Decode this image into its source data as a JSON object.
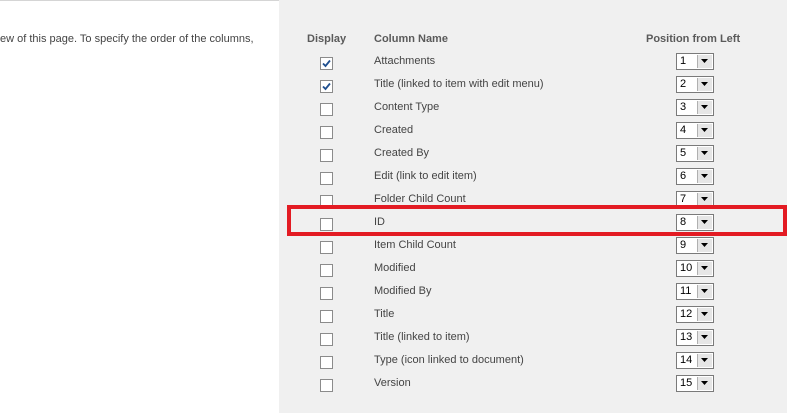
{
  "description": "ew of this page. To specify the order of the columns,",
  "table": {
    "headers": {
      "display": "Display",
      "column_name": "Column Name",
      "position": "Position from Left"
    },
    "rows": [
      {
        "name": "Attachments",
        "checked": true,
        "position": "1"
      },
      {
        "name": "Title (linked to item with edit menu)",
        "checked": true,
        "position": "2"
      },
      {
        "name": "Content Type",
        "checked": false,
        "position": "3"
      },
      {
        "name": "Created",
        "checked": false,
        "position": "4"
      },
      {
        "name": "Created By",
        "checked": false,
        "position": "5"
      },
      {
        "name": "Edit (link to edit item)",
        "checked": false,
        "position": "6"
      },
      {
        "name": "Folder Child Count",
        "checked": false,
        "position": "7"
      },
      {
        "name": "ID",
        "checked": false,
        "position": "8"
      },
      {
        "name": "Item Child Count",
        "checked": false,
        "position": "9"
      },
      {
        "name": "Modified",
        "checked": false,
        "position": "10"
      },
      {
        "name": "Modified By",
        "checked": false,
        "position": "11"
      },
      {
        "name": "Title",
        "checked": false,
        "position": "12"
      },
      {
        "name": "Title (linked to item)",
        "checked": false,
        "position": "13"
      },
      {
        "name": "Type (icon linked to document)",
        "checked": false,
        "position": "14"
      },
      {
        "name": "Version",
        "checked": false,
        "position": "15"
      }
    ]
  },
  "highlighted_row": "ID",
  "colors": {
    "panel_bg": "#f0f0f0",
    "highlight_border": "#e31b23",
    "checkmark": "#1f4f8f"
  },
  "icons": {
    "checkbox_checked": "checkmark-icon",
    "dropdown": "chevron-down-icon"
  }
}
